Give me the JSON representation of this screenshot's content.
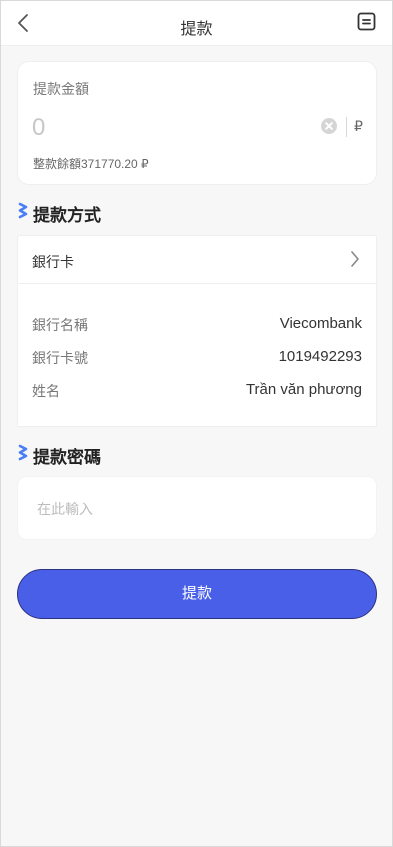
{
  "header": {
    "title": "提款",
    "back_icon": "chevron-left-icon",
    "record_icon": "document-icon"
  },
  "amount": {
    "label": "提款金額",
    "placeholder": "0",
    "currency": "₽",
    "balance_text": "整款餘額371770.20 ₽"
  },
  "method_section": {
    "title": "提款方式"
  },
  "method": {
    "selected": "銀行卡",
    "rows": [
      {
        "label": "銀行名稱",
        "value": "Viecombank"
      },
      {
        "label": "銀行卡號",
        "value": "1019492293"
      },
      {
        "label": "姓名",
        "value": "Trần văn phương"
      }
    ]
  },
  "password_section": {
    "title": "提款密碼",
    "placeholder": "在此輸入"
  },
  "submit": {
    "label": "提款"
  },
  "colors": {
    "accent": "#4a5fe7",
    "section_icon": "#4a7ef5",
    "background": "#f7f7f8"
  }
}
